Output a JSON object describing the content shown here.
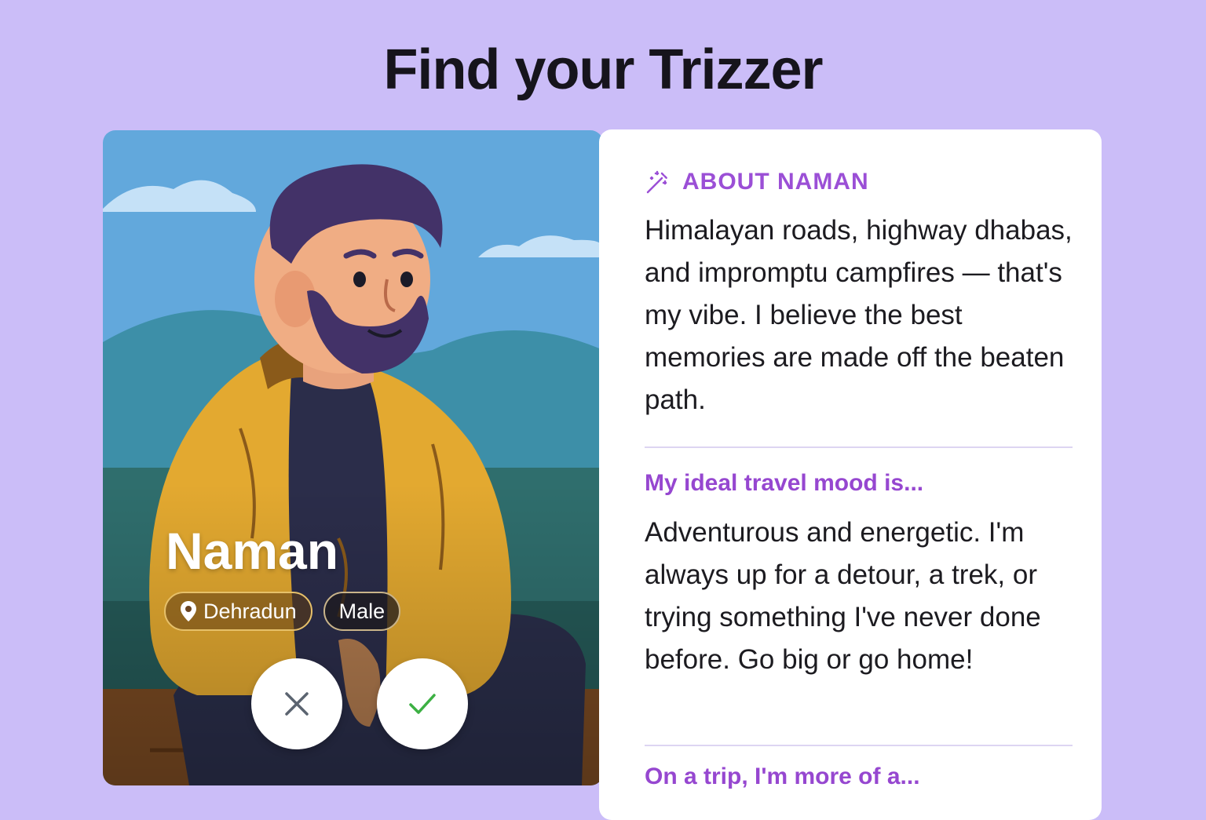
{
  "page": {
    "title": "Find your Trizzer"
  },
  "profile": {
    "name": "Naman",
    "location": "Dehradun",
    "gender": "Male"
  },
  "about": {
    "heading": "ABOUT NAMAN",
    "heading_icon": "sparkle-wand-icon",
    "text": "Himalayan roads, highway dhabas, and impromptu campfires — that's my vibe. I believe the best memories are made off the beaten path."
  },
  "prompts": [
    {
      "question": "My ideal travel mood is...",
      "answer": "Adventurous and energetic. I'm always up for a detour, a trek, or trying something I've never done before. Go big or go home!"
    },
    {
      "question": "On a trip, I'm more of a...",
      "answer": ""
    }
  ],
  "actions": {
    "reject_icon": "close-icon",
    "accept_icon": "check-icon"
  },
  "colors": {
    "background": "#cbbdf8",
    "accent": "#9b4fd6",
    "accept": "#3cb043",
    "reject": "#5b6470"
  }
}
